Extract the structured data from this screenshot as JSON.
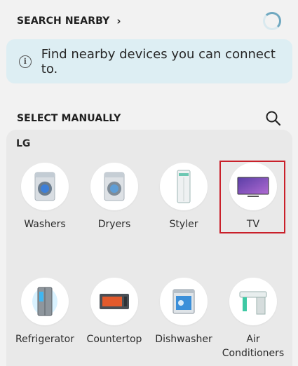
{
  "nearby": {
    "title": "SEARCH NEARBY",
    "chevron": "chevron-right-icon"
  },
  "info": {
    "icon": "info-icon",
    "text": "Find nearby devices you can connect to."
  },
  "manual": {
    "title": "SELECT MANUALLY",
    "search_icon": "search-icon"
  },
  "brand": "LG",
  "devices": [
    {
      "label": "Washers",
      "icon": "washer-icon"
    },
    {
      "label": "Dryers",
      "icon": "dryer-icon"
    },
    {
      "label": "Styler",
      "icon": "styler-icon"
    },
    {
      "label": "TV",
      "icon": "tv-icon",
      "highlighted": true
    },
    {
      "label": "Refrigerator",
      "icon": "refrigerator-icon"
    },
    {
      "label": "Countertop",
      "icon": "countertop-oven-icon"
    },
    {
      "label": "Dishwasher",
      "icon": "dishwasher-icon"
    },
    {
      "label": "Air Conditioners",
      "icon": "air-conditioner-icon"
    }
  ],
  "colors": {
    "info_bg": "#ddeef3",
    "highlight": "#c9202a",
    "panel_bg": "#e9e9e9"
  }
}
